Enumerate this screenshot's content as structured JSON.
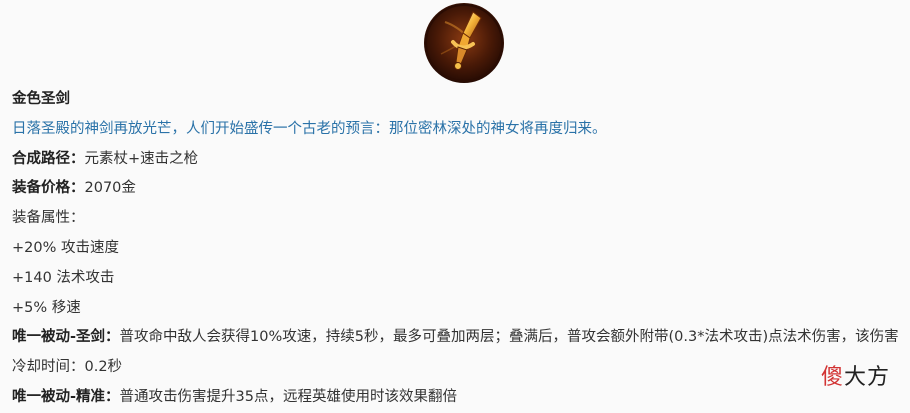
{
  "icon": "golden-sword-icon",
  "item": {
    "name": "金色圣剑",
    "lore": "日落圣殿的神剑再放光芒，人们开始盛传一个古老的预言：那位密林深处的神女将再度归来。",
    "recipe_label": "合成路径：",
    "recipe_value": "元素杖+速击之枪",
    "price_label": "装备价格：",
    "price_value": "2070金",
    "attributes_label": "装备属性：",
    "attributes": [
      "+20% 攻击速度",
      "+140 法术攻击",
      "+5% 移速"
    ],
    "passives": [
      {
        "label": "唯一被动-圣剑：",
        "text": "普攻命中敌人会获得10%攻速，持续5秒，最多可叠加两层；叠满后，普攻会额外附带(0.3*法术攻击)点法术伤害，该伤害冷却时间：0.2秒"
      },
      {
        "label": "唯一被动-精准：",
        "text": "普通攻击伤害提升35点，远程英雄使用时该效果翻倍"
      }
    ]
  },
  "watermark": {
    "first": "傻",
    "rest": "大方"
  },
  "colors": {
    "lore": "#2a72a8",
    "background": "#fafafa",
    "icon_gold": "#f2b13a",
    "icon_dark": "#3a1405"
  }
}
